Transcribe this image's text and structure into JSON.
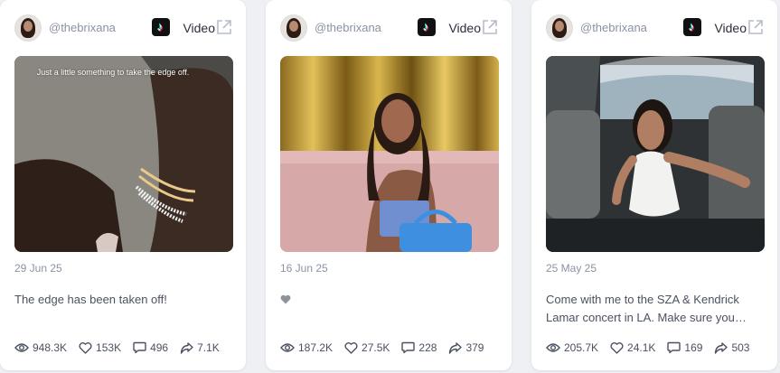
{
  "cards": [
    {
      "username": "@thebrixana",
      "platform_label": "Video",
      "thumbnail_caption": "Just a little something to take the edge off.",
      "date": "29 Jun 25",
      "caption": "The edge has been taken off!",
      "views": "948.3K",
      "likes": "153K",
      "comments": "496",
      "shares": "7.1K"
    },
    {
      "username": "@thebrixana",
      "platform_label": "Video",
      "date": "16 Jun 25",
      "caption_emoji": "grey-heart",
      "views": "187.2K",
      "likes": "27.5K",
      "comments": "228",
      "shares": "379"
    },
    {
      "username": "@thebrixana",
      "platform_label": "Video",
      "date": "25 May 25",
      "caption": "Come with me to the SZA & Kendrick Lamar concert in LA. Make sure you are...",
      "views": "205.7K",
      "likes": "24.1K",
      "comments": "169",
      "shares": "503"
    }
  ],
  "icons": {
    "platform": "tiktok-icon",
    "open": "external-link-icon",
    "views": "eye-icon",
    "likes": "heart-icon",
    "comments": "comment-icon",
    "shares": "share-icon"
  },
  "colors": {
    "muted_text": "#8a93a3",
    "body_text": "#4a5160",
    "card_bg": "#ffffff",
    "page_bg": "#eef0f4"
  }
}
